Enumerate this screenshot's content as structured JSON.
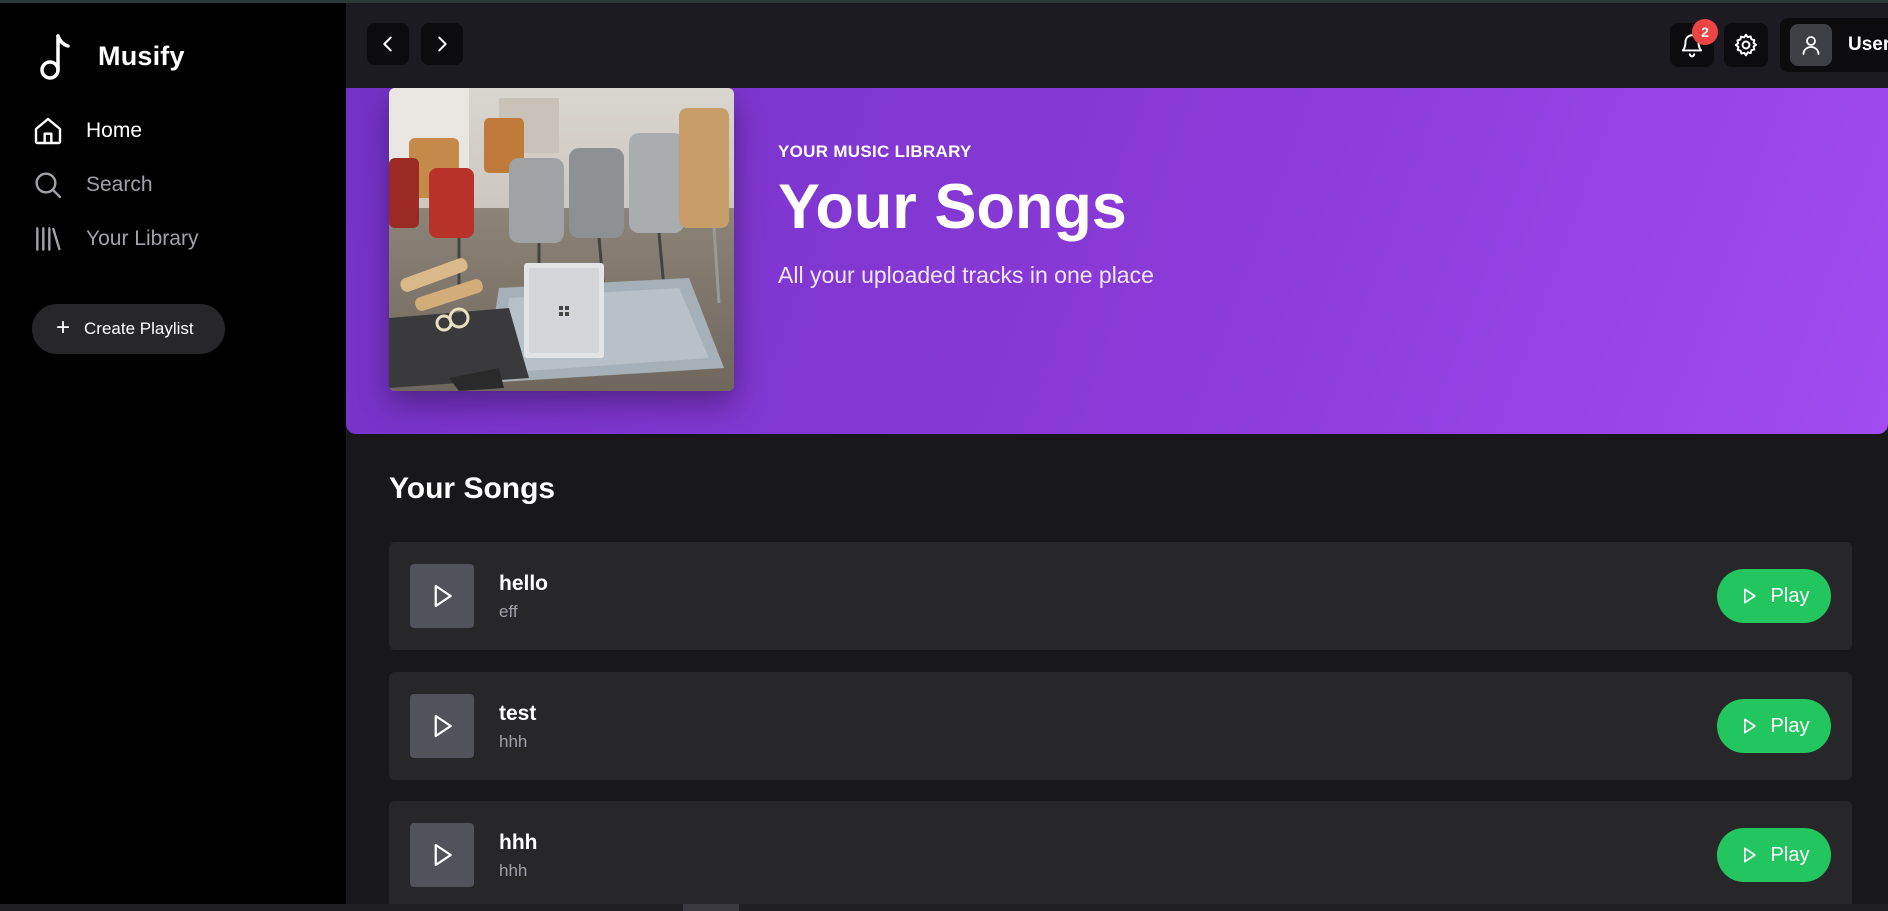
{
  "app": {
    "name": "Musify"
  },
  "sidebar": {
    "items": [
      {
        "label": "Home",
        "icon": "home-icon",
        "active": true
      },
      {
        "label": "Search",
        "icon": "search-icon",
        "active": false
      },
      {
        "label": "Your Library",
        "icon": "library-icon",
        "active": false
      }
    ],
    "create_playlist": "Create Playlist"
  },
  "topbar": {
    "notification_count": "2",
    "user_label": "User"
  },
  "hero": {
    "eyebrow": "YOUR MUSIC LIBRARY",
    "title": "Your Songs",
    "subtitle": "All your uploaded tracks in one place"
  },
  "section": {
    "title": "Your Songs"
  },
  "songs": [
    {
      "title": "hello",
      "artist": "eff",
      "play_label": "Play"
    },
    {
      "title": "test",
      "artist": "hhh",
      "play_label": "Play"
    },
    {
      "title": "hhh",
      "artist": "hhh",
      "play_label": "Play"
    }
  ],
  "colors": {
    "accent": "#22c55e",
    "hero_gradient_start": "#7432c7",
    "hero_gradient_end": "#a04cf0",
    "badge": "#ef4444"
  }
}
